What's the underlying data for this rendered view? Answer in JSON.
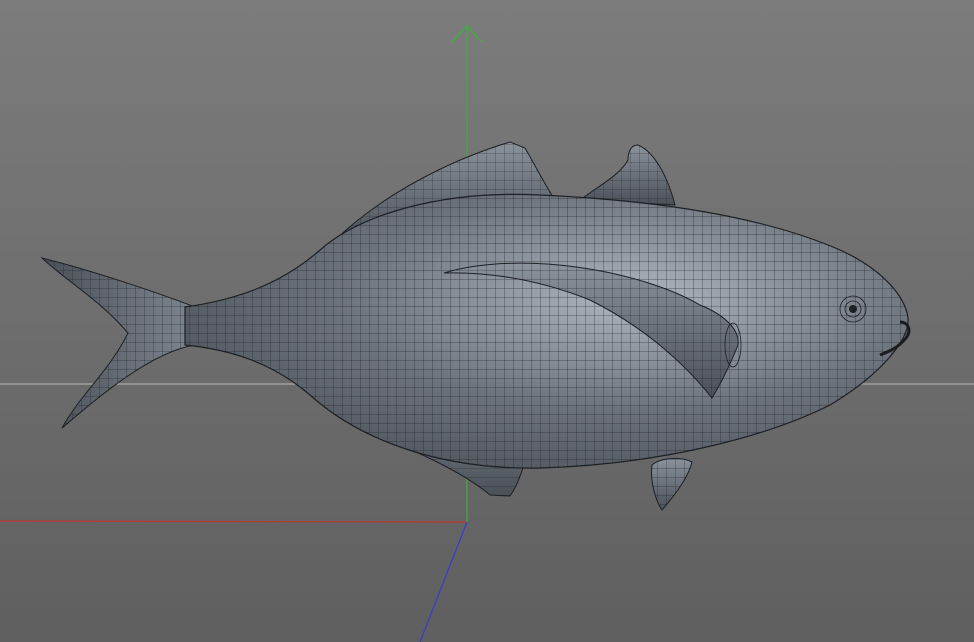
{
  "viewport": {
    "background_top": "#7c7c7c",
    "background_bottom": "#5f5f5f",
    "horizon_color": "#b8b8b8"
  },
  "axes": {
    "x_color": "#c0352f",
    "y_color": "#3fae3f",
    "z_color": "#3a3ad0"
  },
  "model": {
    "name": "fish-mesh",
    "display": "wireframe-on-shaded",
    "body_color": "#4b5058",
    "highlight_color": "#aeb6be",
    "wire_color": "#1d2024"
  }
}
